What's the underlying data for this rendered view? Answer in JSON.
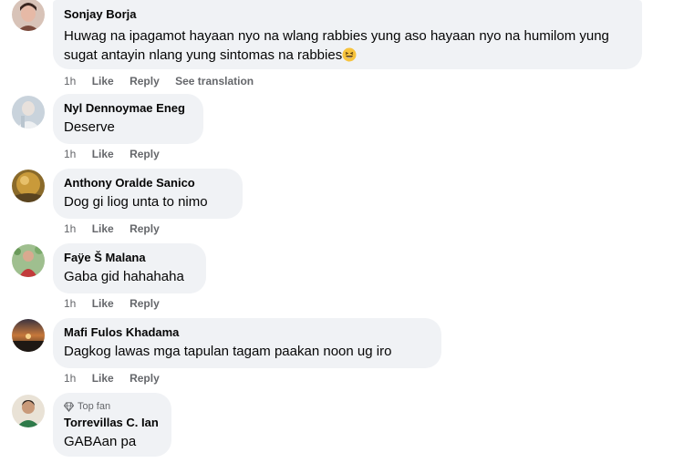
{
  "comments": [
    {
      "author": "Sonjay Borja",
      "text": "Huwag na ipagamot hayaan nyo na wlang rabbies yung aso hayaan nyo na humilom yung sugat antayin nlang yung sintomas na rabbies",
      "emoji": "grinning-squinting-face",
      "time": "1h",
      "like": "Like",
      "reply": "Reply",
      "translate": "See translation"
    },
    {
      "author": "Nyl Dennoymae Eneg",
      "text": "Deserve",
      "time": "1h",
      "like": "Like",
      "reply": "Reply"
    },
    {
      "author": "Anthony Oralde Sanico",
      "text": "Dog gi liog unta to nimo",
      "time": "1h",
      "like": "Like",
      "reply": "Reply"
    },
    {
      "author": "Faÿe Š Malana",
      "text": "Gaba gid hahahaha",
      "time": "1h",
      "like": "Like",
      "reply": "Reply"
    },
    {
      "author": "Mafi Fulos Khadama",
      "text": "Dagkog lawas mga tapulan tagam paakan noon ug iro",
      "time": "1h",
      "like": "Like",
      "reply": "Reply"
    },
    {
      "badge": "Top fan",
      "author": "Torrevillas C. Ian",
      "text": "GABAan pa"
    }
  ],
  "colors": {
    "bubble": "#f0f2f5",
    "meta": "#65676b",
    "text": "#050505"
  }
}
